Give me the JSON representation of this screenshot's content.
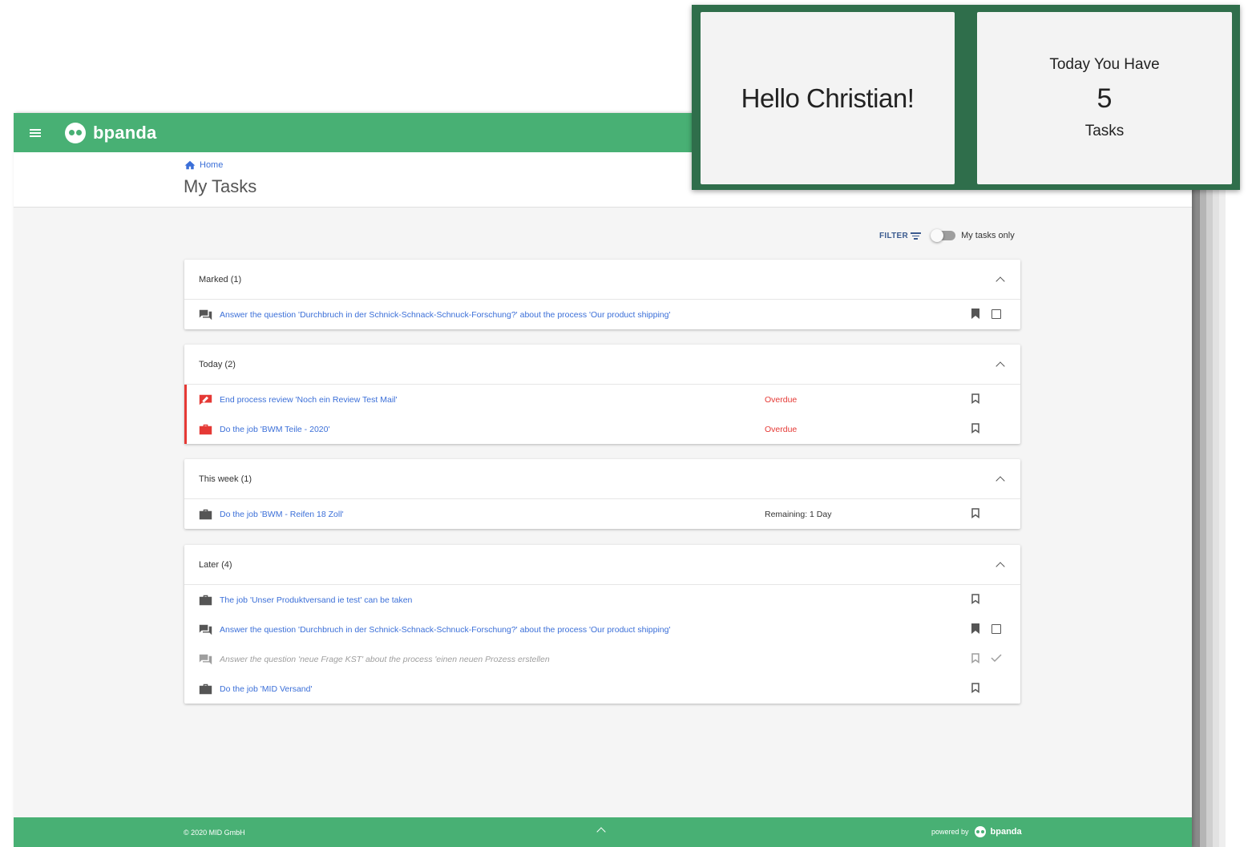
{
  "app": {
    "brand": "bpanda"
  },
  "breadcrumb": {
    "home": "Home"
  },
  "page": {
    "title": "My Tasks"
  },
  "toolbar": {
    "filter_label": "FILTER",
    "toggle_label": "My tasks only",
    "toggle_on": false
  },
  "sections": [
    {
      "title": "Marked (1)",
      "tasks": [
        {
          "icon": "question-answer-icon",
          "text": "Answer the question 'Durchbruch in der Schnick-Schnack-Schnuck-Forschung?' about the process 'Our product shipping'",
          "status": "",
          "bookmarked": true,
          "checkbox": "empty"
        }
      ]
    },
    {
      "title": "Today (2)",
      "tasks": [
        {
          "icon": "review-icon",
          "text": "End process review 'Noch ein Review Test Mail'",
          "status": "Overdue",
          "bookmarked": false,
          "checkbox": "none"
        },
        {
          "icon": "briefcase-icon",
          "text": "Do the job 'BWM Teile - 2020'",
          "status": "Overdue",
          "bookmarked": false,
          "checkbox": "none"
        }
      ]
    },
    {
      "title": "This week (1)",
      "tasks": [
        {
          "icon": "briefcase-icon",
          "text": "Do the job 'BWM - Reifen 18 Zoll'",
          "status": "Remaining: 1 Day",
          "bookmarked": false,
          "checkbox": "none"
        }
      ]
    },
    {
      "title": "Later (4)",
      "tasks": [
        {
          "icon": "briefcase-icon",
          "text": "The job 'Unser Produktversand ie test' can be taken",
          "status": "",
          "bookmarked": false,
          "checkbox": "none"
        },
        {
          "icon": "question-answer-icon",
          "text": "Answer the question 'Durchbruch in der Schnick-Schnack-Schnuck-Forschung?' about the process 'Our product shipping'",
          "status": "",
          "bookmarked": true,
          "checkbox": "empty"
        },
        {
          "icon": "question-answer-icon",
          "text": "Answer the question 'neue Frage KST' about the process 'einen neuen Prozess erstellen",
          "status": "",
          "bookmarked": false,
          "checkbox": "checked",
          "muted": true
        },
        {
          "icon": "briefcase-icon",
          "text": "Do the job 'MID Versand'",
          "status": "",
          "bookmarked": false,
          "checkbox": "none"
        }
      ]
    }
  ],
  "footer": {
    "copyright": "© 2020 MID GmbH",
    "powered_by": "powered by",
    "brand": "bpanda"
  },
  "overlay": {
    "greeting": "Hello Christian!",
    "today_label": "Today You Have",
    "today_count": "5",
    "today_unit": "Tasks"
  },
  "colors": {
    "brand_green": "#48b074",
    "overlay_green": "#2f6e4b",
    "link_blue": "#3b6fd8",
    "overdue_red": "#e53935"
  }
}
